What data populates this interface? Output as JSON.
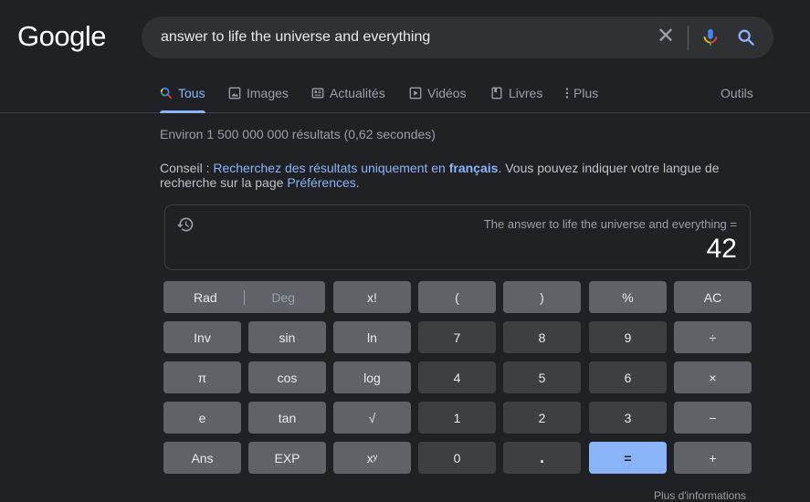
{
  "header": {
    "logo": "Google",
    "search": {
      "query": "answer to life the universe and everything",
      "clear_icon": "close-icon",
      "voice_icon": "microphone-icon",
      "search_icon": "search-icon"
    }
  },
  "tabs": [
    {
      "label": "Tous",
      "icon": "search-icon",
      "active": true
    },
    {
      "label": "Images",
      "icon": "image-icon",
      "active": false
    },
    {
      "label": "Actualités",
      "icon": "news-icon",
      "active": false
    },
    {
      "label": "Vidéos",
      "icon": "play-icon",
      "active": false
    },
    {
      "label": "Livres",
      "icon": "book-icon",
      "active": false
    },
    {
      "label": "Plus",
      "icon": "more-vert-icon",
      "active": false
    }
  ],
  "tools_label": "Outils",
  "stats": "Environ 1 500 000 000 résultats (0,62 secondes)",
  "conseil": {
    "prefix": "Conseil : ",
    "link1": "Recherchez des résultats uniquement en ",
    "link1_bold": "français",
    "middle": ". Vous pouvez indiquer votre langue de recherche sur la page ",
    "link2": "Préférences",
    "suffix": "."
  },
  "calculator": {
    "expression": "The answer to life the universe and everything =",
    "result": "42",
    "history_icon": "history-icon",
    "rad_label": "Rad",
    "deg_label": "Deg",
    "keys": [
      [
        "x!",
        "(",
        ")",
        "%",
        "AC"
      ],
      [
        "Inv",
        "sin",
        "ln",
        "7",
        "8",
        "9",
        "÷"
      ],
      [
        "π",
        "cos",
        "log",
        "4",
        "5",
        "6",
        "×"
      ],
      [
        "e",
        "tan",
        "√",
        "1",
        "2",
        "3",
        "−"
      ],
      [
        "Ans",
        "EXP",
        "xʸ",
        "0",
        ".",
        "=",
        "+"
      ]
    ]
  },
  "bottom_text": "Plus d'informations",
  "colors": {
    "background": "#202124",
    "accent": "#8ab4f8",
    "key_function": "#5f6368",
    "key_number": "#3c4043"
  }
}
